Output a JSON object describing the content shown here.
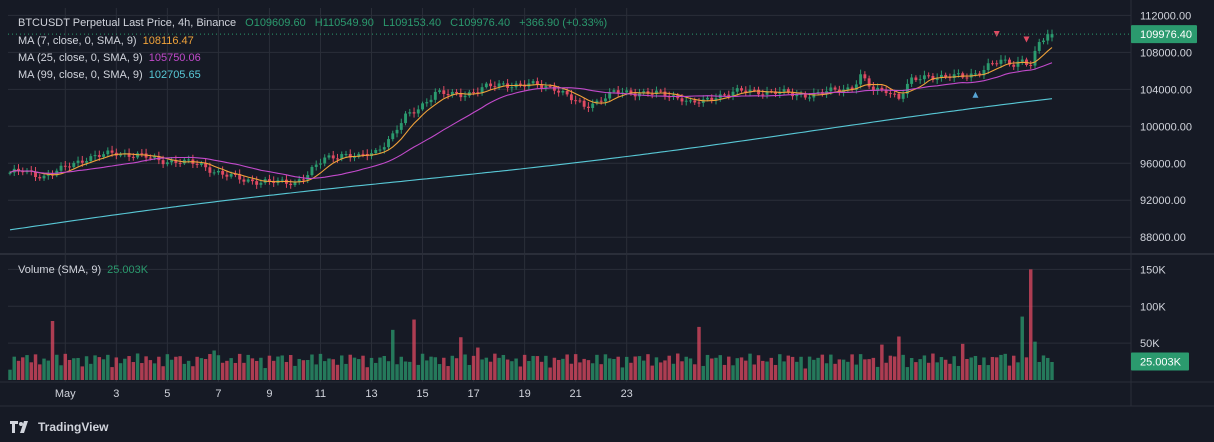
{
  "header": {
    "symbol_line": "BTCUSDT Perpetual Last Price, 4h, Binance",
    "open": "O109609.60",
    "high": "H110549.90",
    "low": "L109153.40",
    "close": "C109976.40",
    "change": "+366.90 (+0.33%)"
  },
  "indicators": [
    {
      "label": "MA (7, close, 0, SMA, 9)",
      "value": "108116.47",
      "color": "#f0a23a"
    },
    {
      "label": "MA (25, close, 0, SMA, 9)",
      "value": "105750.06",
      "color": "#c24acb"
    },
    {
      "label": "MA (99, close, 0, SMA, 9)",
      "value": "102705.65",
      "color": "#58c8d6"
    }
  ],
  "volume_legend": {
    "label": "Volume (SMA, 9)",
    "value": "25.003K"
  },
  "colors": {
    "up": "#2b9a6e",
    "down": "#e04a62",
    "background": "#161a25",
    "grid": "#2a2e39"
  },
  "branding": {
    "text": "TradingView",
    "icon": "tradingview-logo-icon"
  },
  "chart_data": {
    "type": "candlestick",
    "price_axis": {
      "ticks": [
        "112000.00",
        "108000.00",
        "104000.00",
        "100000.00",
        "96000.00",
        "92000.00",
        "88000.00"
      ],
      "range": [
        86400,
        112800
      ]
    },
    "volume_axis": {
      "ticks": [
        "150K",
        "100K",
        "50K"
      ],
      "range": [
        0,
        160000
      ]
    },
    "x_ticks": [
      "May",
      "3",
      "5",
      "7",
      "9",
      "11",
      "13",
      "15",
      "17",
      "19",
      "21",
      "23"
    ],
    "last_price_label": "109976.40",
    "last_volume_label": "25.003K",
    "closes_keypoints": [
      [
        0,
        95000
      ],
      [
        3,
        95100
      ],
      [
        8,
        94600
      ],
      [
        12,
        95300
      ],
      [
        18,
        96600
      ],
      [
        25,
        97100
      ],
      [
        30,
        96900
      ],
      [
        35,
        96300
      ],
      [
        40,
        96200
      ],
      [
        45,
        95800
      ],
      [
        50,
        94800
      ],
      [
        55,
        94200
      ],
      [
        60,
        94000
      ],
      [
        64,
        93900
      ],
      [
        67,
        94000
      ],
      [
        70,
        94800
      ],
      [
        74,
        96500
      ],
      [
        78,
        97000
      ],
      [
        82,
        96600
      ],
      [
        86,
        97300
      ],
      [
        90,
        99000
      ],
      [
        93,
        101000
      ],
      [
        96,
        102000
      ],
      [
        100,
        103600
      ],
      [
        103,
        103400
      ],
      [
        108,
        103600
      ],
      [
        112,
        104200
      ],
      [
        116,
        104600
      ],
      [
        120,
        104400
      ],
      [
        124,
        104500
      ],
      [
        128,
        104200
      ],
      [
        132,
        102900
      ],
      [
        135,
        102200
      ],
      [
        138,
        102700
      ],
      [
        142,
        103600
      ],
      [
        146,
        103700
      ],
      [
        150,
        103600
      ],
      [
        154,
        103400
      ],
      [
        158,
        103100
      ],
      [
        160,
        102500
      ],
      [
        163,
        102600
      ],
      [
        166,
        103300
      ],
      [
        170,
        103700
      ],
      [
        175,
        103800
      ],
      [
        180,
        103700
      ],
      [
        185,
        103400
      ],
      [
        190,
        103500
      ],
      [
        195,
        104000
      ],
      [
        198,
        104200
      ],
      [
        200,
        105400
      ],
      [
        203,
        103800
      ],
      [
        206,
        104000
      ],
      [
        209,
        103100
      ],
      [
        212,
        104900
      ],
      [
        216,
        105500
      ],
      [
        220,
        105300
      ],
      [
        224,
        105400
      ],
      [
        228,
        105900
      ],
      [
        230,
        106500
      ],
      [
        233,
        107000
      ],
      [
        236,
        106800
      ],
      [
        238,
        107200
      ],
      [
        240,
        106600
      ],
      [
        242,
        108900
      ],
      [
        244,
        109900
      ],
      [
        245,
        109976
      ]
    ],
    "volume_spikes": [
      [
        10,
        80000
      ],
      [
        42,
        26000
      ],
      [
        48,
        40000
      ],
      [
        90,
        68000
      ],
      [
        95,
        82000
      ],
      [
        106,
        58000
      ],
      [
        110,
        44000
      ],
      [
        115,
        30000
      ],
      [
        162,
        72000
      ],
      [
        205,
        48000
      ],
      [
        209,
        59000
      ],
      [
        224,
        49000
      ],
      [
        233,
        34000
      ],
      [
        238,
        86000
      ],
      [
        240,
        150000
      ],
      [
        241,
        52000
      ]
    ],
    "markers": [
      "sell-arrow-down",
      "sell-arrow-down",
      "buy-arrow-up"
    ]
  }
}
